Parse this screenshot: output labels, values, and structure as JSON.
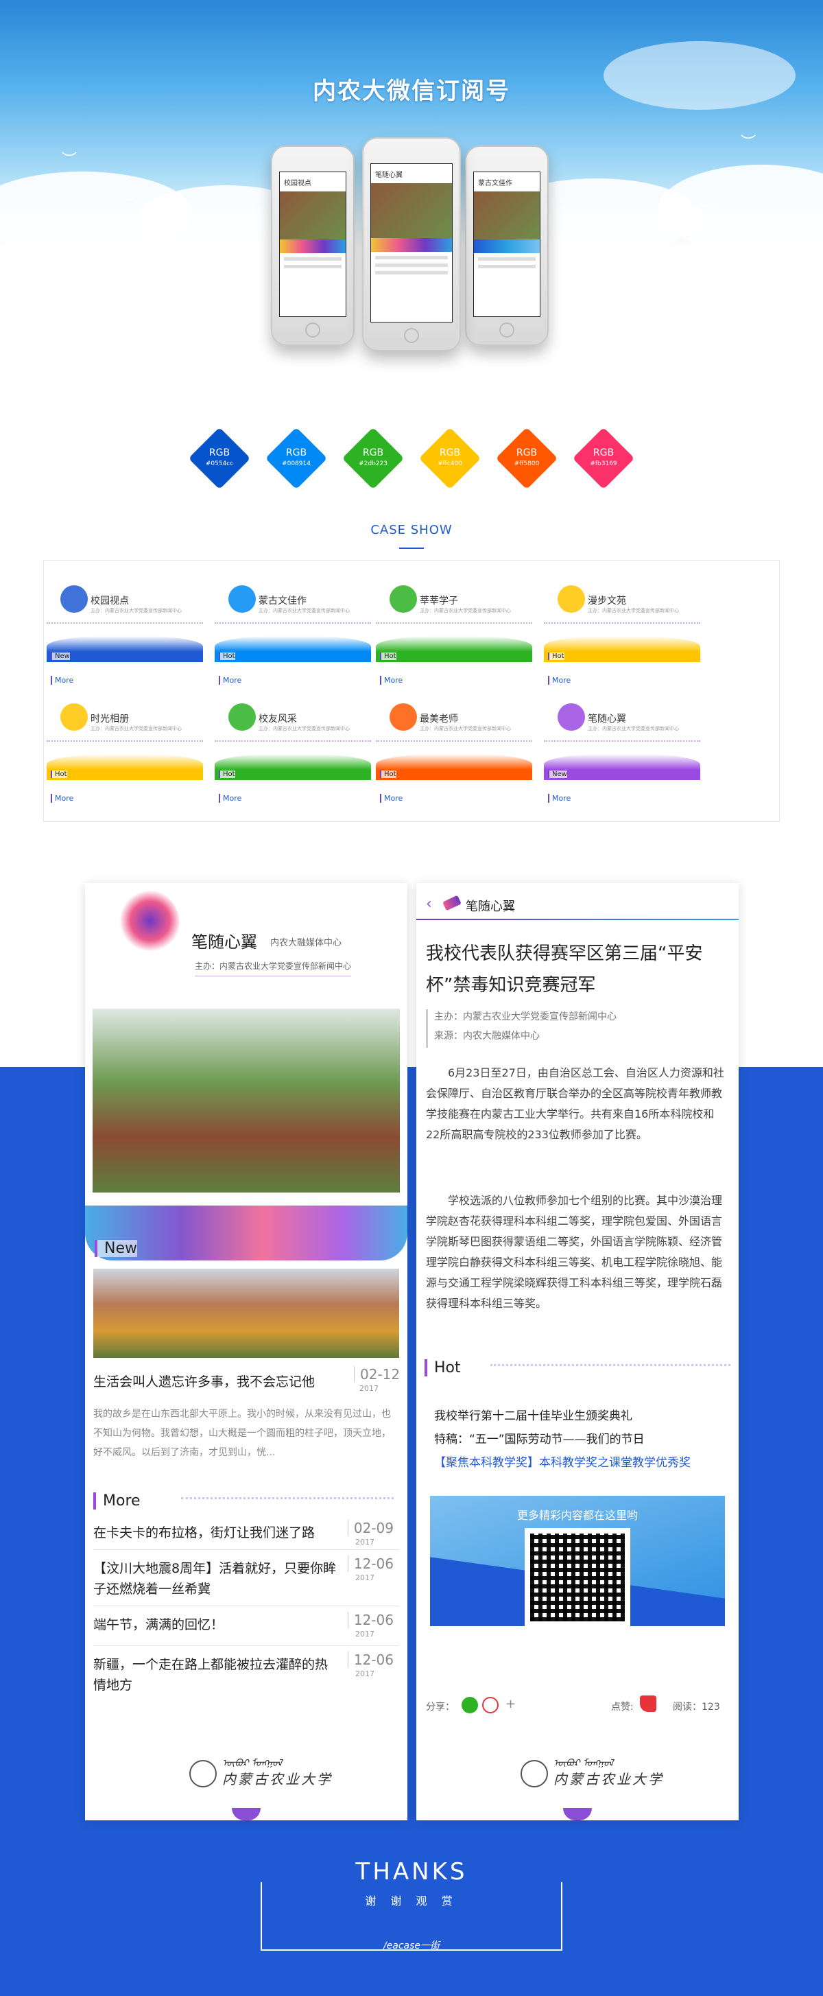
{
  "hero": {
    "title": "内农大微信订阅号"
  },
  "phones": [
    {
      "screen_title": "校园视点"
    },
    {
      "screen_title": "笔随心翼"
    },
    {
      "screen_title": "蒙古文佳作"
    }
  ],
  "palette": [
    {
      "label": "RGB",
      "hex_text": "#0554cc",
      "color": "#0554cc"
    },
    {
      "label": "RGB",
      "hex_text": "#008914",
      "color": "#0089f4"
    },
    {
      "label": "RGB",
      "hex_text": "#2db223",
      "color": "#2db223"
    },
    {
      "label": "RGB",
      "hex_text": "#ffc400",
      "color": "#ffc400"
    },
    {
      "label": "RGB",
      "hex_text": "#ff5800",
      "color": "#ff5800"
    },
    {
      "label": "RGB",
      "hex_text": "#fb3169",
      "color": "#fb3169"
    }
  ],
  "case_show": {
    "title": "CASE SHOW",
    "cards": [
      {
        "name": "校园视点",
        "sub": "主办：内蒙古农业大学党委宣传部新闻中心",
        "tag": "New",
        "more": "More",
        "color": "#1f5ad4"
      },
      {
        "name": "蒙古文佳作",
        "sub": "主办：内蒙古农业大学党委宣传部新闻中心",
        "tag": "Hot",
        "more": "More",
        "color": "#0089f4"
      },
      {
        "name": "莘莘学子",
        "sub": "主办：内蒙古农业大学党委宣传部新闻中心",
        "tag": "Hot",
        "more": "More",
        "color": "#2db223"
      },
      {
        "name": "漫步文苑",
        "sub": "主办：内蒙古农业大学党委宣传部新闻中心",
        "tag": "Hot",
        "more": "More",
        "color": "#ffc400"
      },
      {
        "name": "时光相册",
        "sub": "主办：内蒙古农业大学党委宣传部新闻中心",
        "tag": "Hot",
        "more": "More",
        "color": "#ffc400"
      },
      {
        "name": "校友风采",
        "sub": "主办：内蒙古农业大学党委宣传部新闻中心",
        "tag": "Hot",
        "more": "More",
        "color": "#2db223"
      },
      {
        "name": "最美老师",
        "sub": "主办：内蒙古农业大学党委宣传部新闻中心",
        "tag": "Hot",
        "more": "More",
        "color": "#ff5800"
      },
      {
        "name": "笔随心翼",
        "sub": "主办：内蒙古农业大学党委宣传部新闻中心",
        "tag": "New",
        "more": "More",
        "color": "#9a4ae0"
      }
    ]
  },
  "left_phone": {
    "title": "笔随心翼",
    "media": "内农大融媒体中心",
    "host": "主办：内蒙古农业大学党委宣传部新闻中心",
    "new_label": "New",
    "feature_title": "生活会叫人遗忘许多事，我不会忘记他",
    "feature_date": "02-12",
    "feature_year": "2017",
    "feature_excerpt": "我的故乡是在山东西北部大平原上。我小的时候，从来没有见过山，也不知山为何物。我曾幻想，山大概是一个圆而粗的柱子吧，顶天立地，好不威风。以后到了济南，才见到山，恍...",
    "more_label": "More",
    "items": [
      {
        "title": "在卡夫卡的布拉格，街灯让我们迷了路",
        "date": "02-09",
        "year": "2017"
      },
      {
        "title": "【汶川大地震8周年】活着就好，只要你眸子还燃烧着一丝希冀",
        "date": "12-06",
        "year": "2017"
      },
      {
        "title": "端午节，满满的回忆！",
        "date": "12-06",
        "year": "2017"
      },
      {
        "title": "新疆，一个走在路上都能被拉去灌醉的热情地方",
        "date": "12-06",
        "year": "2017"
      }
    ],
    "footer_script": "ᠦᠪᠦᠷ ᠮᠣᠩᠭᠣᠯ",
    "footer_cn": "内蒙古农业大学"
  },
  "right_phone": {
    "header": "笔随心翼",
    "article_title": "我校代表队获得赛罕区第三届“平安杯”禁毒知识竞赛冠军",
    "host": "主办：内蒙古农业大学党委宣传部新闻中心",
    "source": "来源：内农大融媒体中心",
    "para1": "6月23日至27日，由自治区总工会、自治区人力资源和社会保障厅、自治区教育厅联合举办的全区高等院校青年教师教学技能赛在内蒙古工业大学举行。共有来自16所本科院校和22所高职高专院校的233位教师参加了比赛。",
    "para2": "学校选派的八位教师参加七个组别的比赛。其中沙漠治理学院赵杏花获得理科本科组二等奖，理学院包爱国、外国语言学院斯琴巴图获得蒙语组二等奖，外国语言学院陈颖、经济管理学院白静获得文科本科组三等奖、机电工程学院徐晓旭、能源与交通工程学院梁晓辉获得工科本科组三等奖，理学院石磊获得理科本科组三等奖。",
    "hot_label": "Hot",
    "hot_items": [
      "我校举行第十二届十佳毕业生颁奖典礼",
      "特稿：“五一”国际劳动节——我们的节日",
      "【聚焦本科教学奖】本科教学奖之课堂教学优秀奖"
    ],
    "qr_caption": "更多精彩内容都在这里哟",
    "share_label": "分享：",
    "like_label": "点赞:",
    "read_label": "阅读：123",
    "plus": "+",
    "footer_script": "ᠦᠪᠦᠷ ᠮᠣᠩᠭᠣᠯ",
    "footer_cn": "内蒙古农业大学"
  },
  "thanks": {
    "title": "THANKS",
    "sub": "谢 谢 观 赏",
    "brand": "/eacase一街"
  }
}
